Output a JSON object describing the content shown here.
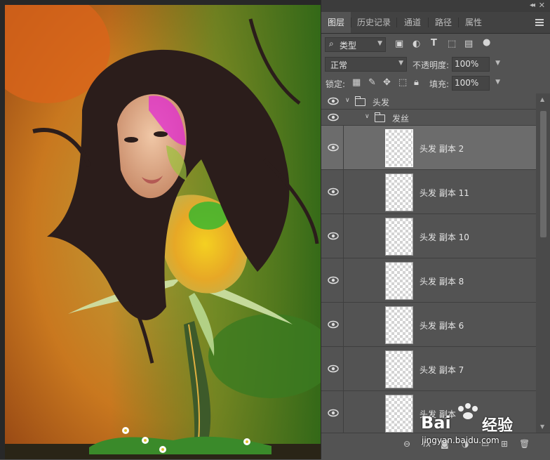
{
  "panel": {
    "tabs": [
      {
        "label": "图层",
        "active": true
      },
      {
        "label": "历史记录"
      },
      {
        "label": "通道"
      },
      {
        "label": "路径"
      },
      {
        "label": "属性"
      }
    ],
    "filter_kind": "类型",
    "blend_mode": "正常",
    "opacity_label": "不透明度:",
    "opacity_value": "100%",
    "lock_label": "锁定:",
    "fill_label": "填充:",
    "fill_value": "100%",
    "groups": [
      {
        "name": "头发"
      },
      {
        "name": "发丝"
      }
    ],
    "layers": [
      {
        "name": "头发 副本 2",
        "selected": true
      },
      {
        "name": "头发 副本 11"
      },
      {
        "name": "头发 副本 10"
      },
      {
        "name": "头发 副本 8"
      },
      {
        "name": "头发 副本 6"
      },
      {
        "name": "头发 副本 7"
      },
      {
        "name": "头发 副本"
      }
    ]
  },
  "watermark": {
    "brand": "Bai",
    "brand2": "经验",
    "url": "jingyan.baidu.com"
  },
  "colors": {
    "panel_bg": "#535353",
    "selected_row": "#6c6c6c",
    "accent_watermark": "#ffffff"
  }
}
